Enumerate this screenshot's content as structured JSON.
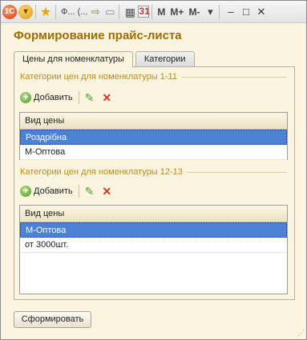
{
  "titlebar": {
    "title": "Ф... (...",
    "mem_buttons": [
      "M",
      "M+",
      "M-"
    ],
    "controls": [
      "–",
      "□",
      "✕"
    ]
  },
  "form": {
    "title": "Формирование прайс-листа"
  },
  "tabs": [
    {
      "label": "Цены для номенклатуры",
      "active": true
    },
    {
      "label": "Категории",
      "active": false
    }
  ],
  "sections": [
    {
      "title": "Категории цен для номенклатуры 1-11",
      "add_label": "Добавить",
      "column_header": "Вид цены",
      "rows": [
        {
          "value": "Роздрібна",
          "selected": true
        },
        {
          "value": "М-Оптова",
          "selected": false
        }
      ]
    },
    {
      "title": "Категории цен для номенклатуры 12-13",
      "add_label": "Добавить",
      "column_header": "Вид цены",
      "rows": [
        {
          "value": "М-Оптова",
          "selected": true
        },
        {
          "value": "от 3000шт.",
          "selected": false
        }
      ]
    }
  ],
  "actions": {
    "generate_label": "Сформировать"
  }
}
